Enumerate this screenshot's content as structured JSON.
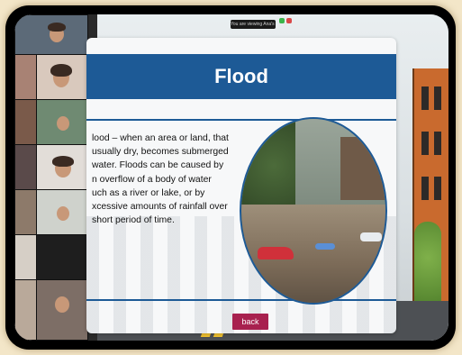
{
  "zoom": {
    "top_bar_text": "You are viewing Ana's Screen",
    "indicator_colors": [
      "#3bb54a",
      "#d94848"
    ]
  },
  "gallery": {
    "participants": [
      "",
      "",
      "",
      "",
      "",
      "",
      "",
      ""
    ]
  },
  "slide": {
    "title": "Flood",
    "description": "lood – when an area or land, that\n usually dry, becomes submerged\n water. Floods can be caused by\nn overflow of a body of water\nuch as a river or lake, or by\nxcessive amounts of rainfall over\n short period of time.",
    "back_label": "back",
    "image_name": "flooded-street-photo",
    "accent_color": "#1d5a96",
    "button_color": "#a8214f"
  }
}
